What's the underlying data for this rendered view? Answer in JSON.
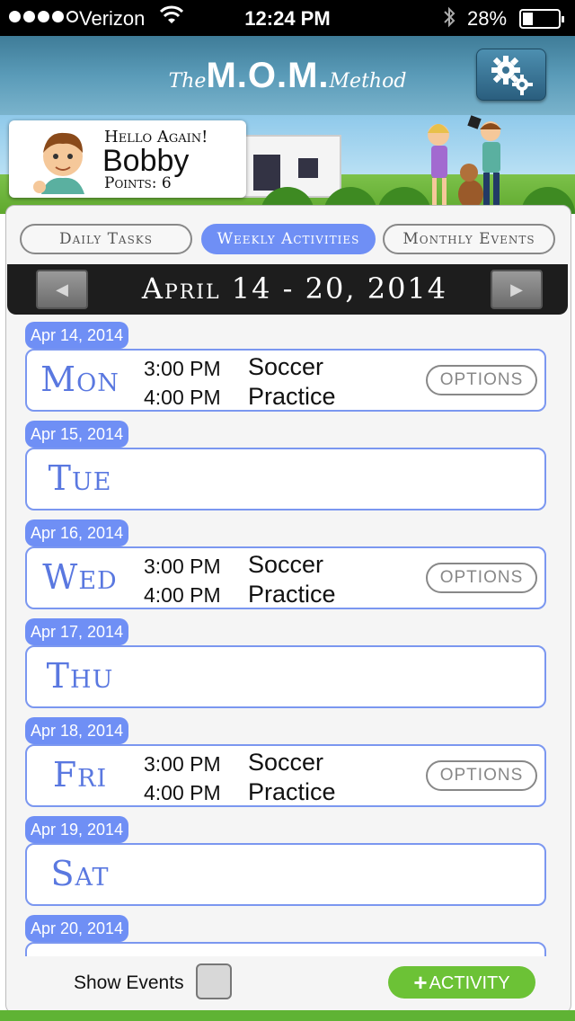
{
  "status_bar": {
    "carrier": "Verizon",
    "time": "12:24 PM",
    "battery": "28%"
  },
  "header": {
    "logo_the": "The",
    "logo_mom": "M.O.M.",
    "logo_method": "Method",
    "settings_icon": "gears-icon"
  },
  "greeting": {
    "hello": "Hello Again!",
    "name": "Bobby",
    "points": "Points: 6"
  },
  "tabs": [
    {
      "label": "Daily Tasks",
      "active": false
    },
    {
      "label": "Weekly Activities",
      "active": true
    },
    {
      "label": "Monthly Events",
      "active": false
    }
  ],
  "week": {
    "title": "April 14 - 20, 2014",
    "prev_icon": "◀",
    "next_icon": "▶"
  },
  "days": [
    {
      "date": "Apr 14, 2014",
      "name": "Mon",
      "times": [
        "3:00 PM",
        "4:00 PM"
      ],
      "activity": [
        "Soccer",
        "Practice"
      ],
      "options": "OPTIONS"
    },
    {
      "date": "Apr 15, 2014",
      "name": "Tue"
    },
    {
      "date": "Apr 16, 2014",
      "name": "Wed",
      "times": [
        "3:00 PM",
        "4:00 PM"
      ],
      "activity": [
        "Soccer",
        "Practice"
      ],
      "options": "OPTIONS"
    },
    {
      "date": "Apr 17, 2014",
      "name": "Thu"
    },
    {
      "date": "Apr 18, 2014",
      "name": "Fri",
      "times": [
        "3:00 PM",
        "4:00 PM"
      ],
      "activity": [
        "Soccer",
        "Practice"
      ],
      "options": "OPTIONS"
    },
    {
      "date": "Apr 19, 2014",
      "name": "Sat"
    },
    {
      "date": "Apr 20, 2014",
      "name": ""
    }
  ],
  "footer": {
    "show_events_label": "Show Events",
    "add_activity_label": "ACTIVITY",
    "add_activity_icon": "+"
  },
  "colors": {
    "accent_blue": "#6f8ff5",
    "green": "#6cc236",
    "header_blue": "#4d8fb0"
  }
}
